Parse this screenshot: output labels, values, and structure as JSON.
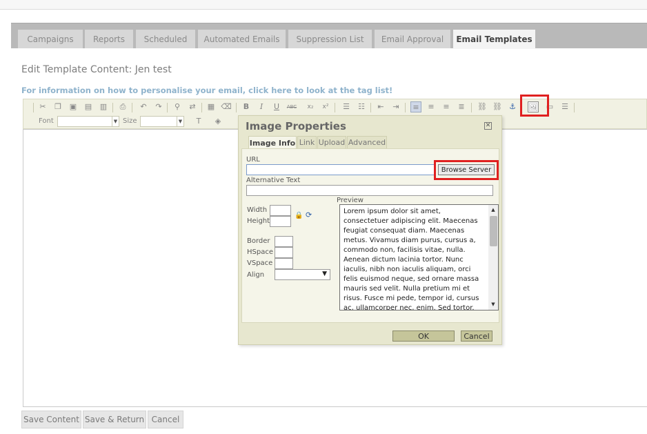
{
  "tabs": [
    {
      "label": "Campaigns"
    },
    {
      "label": "Reports"
    },
    {
      "label": "Scheduled"
    },
    {
      "label": "Automated Emails"
    },
    {
      "label": "Suppression List"
    },
    {
      "label": "Email Approval"
    },
    {
      "label": "Email Templates"
    }
  ],
  "page": {
    "title": "Edit Template Content: Jen test",
    "info_link": "For information on how to personalise your email, click here to look at the tag list!"
  },
  "toolbar": {
    "font_label": "Font",
    "size_label": "Size"
  },
  "dialog": {
    "title": "Image Properties",
    "close_glyph": "✕",
    "tabs": [
      "Image Info",
      "Link",
      "Upload",
      "Advanced"
    ],
    "url_label": "URL",
    "url_value": "",
    "browse_label": "Browse Server",
    "alt_label": "Alternative Text",
    "alt_value": "",
    "width_label": "Width",
    "height_label": "Height",
    "border_label": "Border",
    "hspace_label": "HSpace",
    "vspace_label": "VSpace",
    "align_label": "Align",
    "align_value": "",
    "preview_label": "Preview",
    "preview_text": "Lorem ipsum dolor sit amet, consectetuer adipiscing elit. Maecenas feugiat consequat diam. Maecenas metus. Vivamus diam purus, cursus a, commodo non, facilisis vitae, nulla. Aenean dictum lacinia tortor. Nunc iaculis, nibh non iaculis aliquam, orci felis euismod neque, sed ornare massa mauris sed velit. Nulla pretium mi et risus. Fusce mi pede, tempor id, cursus ac, ullamcorper nec, enim. Sed tortor. Curabitur molestie. Duis velit",
    "ok_label": "OK",
    "cancel_label": "Cancel"
  },
  "bottom_buttons": {
    "save_content": "Save Content",
    "save_return": "Save & Return",
    "cancel": "Cancel"
  },
  "colors": {
    "highlight": "#e02020",
    "link": "#8fb3cc"
  }
}
